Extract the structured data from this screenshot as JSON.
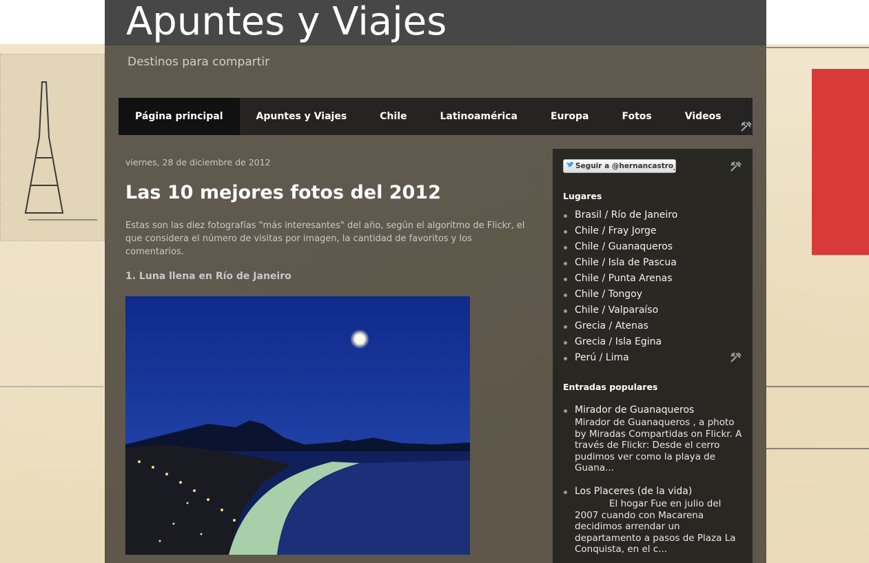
{
  "header": {
    "title": "Apuntes y Viajes",
    "description": "Destinos para compartir"
  },
  "nav": {
    "items": [
      {
        "label": "Página principal",
        "active": true
      },
      {
        "label": "Apuntes y Viajes",
        "active": false
      },
      {
        "label": "Chile",
        "active": false
      },
      {
        "label": "Latinoamérica",
        "active": false
      },
      {
        "label": "Europa",
        "active": false
      },
      {
        "label": "Fotos",
        "active": false
      },
      {
        "label": "Videos",
        "active": false
      }
    ]
  },
  "post": {
    "date": "viernes, 28 de diciembre de 2012",
    "title": "Las 10 mejores fotos del 2012",
    "intro": "Estas son las diez fotografías \"más interesantes\" del año, según el algoritmo de Flickr, el que considera el número de visitas por imagen, la cantidad de favoritos y los comentarios.",
    "subheading": "1. Luna llena en Río de Janeiro"
  },
  "sidebar": {
    "follow_label": "Seguir a @hernancastro_",
    "places_title": "Lugares",
    "places": [
      "Brasil / Río de Janeiro",
      "Chile / Fray Jorge",
      "Chile / Guanaqueros",
      "Chile / Isla de Pascua",
      "Chile / Punta Arenas",
      "Chile / Tongoy",
      "Chile / Valparaíso",
      "Grecia / Atenas",
      "Grecia / Isla Egina",
      "Perú / Lima"
    ],
    "popular_title": "Entradas populares",
    "popular": [
      {
        "title": "Mirador de Guanaqueros",
        "snippet": "Mirador de Guanaqueros , a photo by Miradas Compartidas on Flickr. A través de Flickr: Desde el cerro pudimos ver como la playa de Guana..."
      },
      {
        "title": "Los Placeres (de la vida)",
        "snippet": "El hogar Fue en julio del 2007 cuando con Macarena decidimos arrendar un departamento a pasos de Plaza La Conquista, en el c..."
      }
    ]
  },
  "colors": {
    "header_bar": "#474747",
    "nav_bg": "#1e1e1e",
    "text_light": "#c9c9c9",
    "twitter_blue": "#3aa3e3"
  },
  "icons": [
    "wrench-icon",
    "twitter-bird-icon",
    "bullet-icon"
  ]
}
